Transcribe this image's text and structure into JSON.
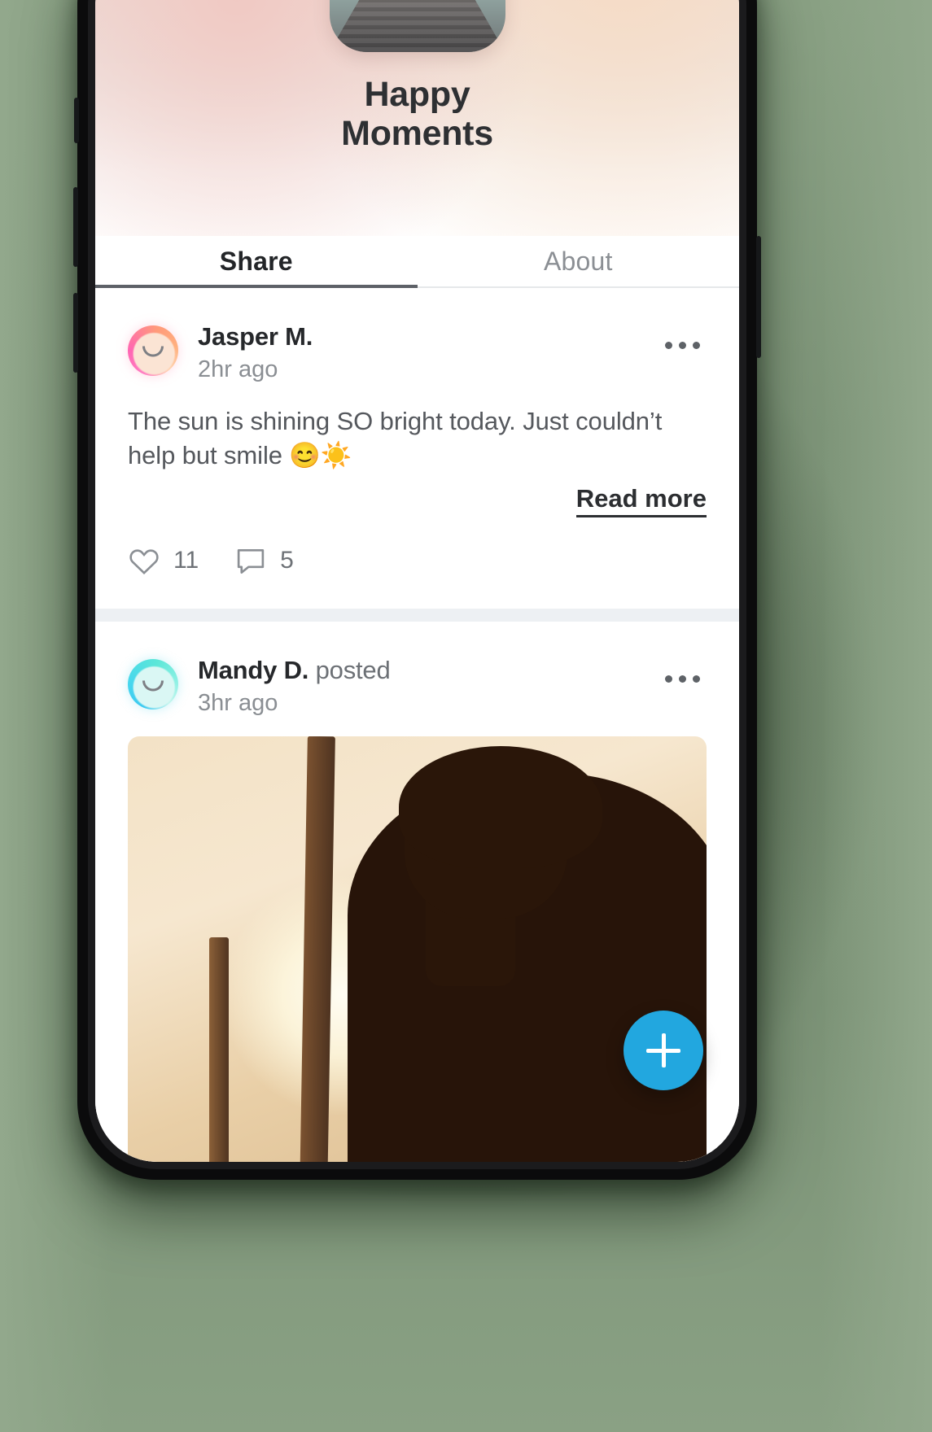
{
  "app": {
    "title_line1": "Happy",
    "title_line2": "Moments",
    "icon_name": "happy-moments-app-icon",
    "accent_color": "#22a7df",
    "tab_indicator_color": "#5d6167"
  },
  "tabs": [
    {
      "label": "Share",
      "active": true
    },
    {
      "label": "About",
      "active": false
    }
  ],
  "feed": {
    "posts": [
      {
        "author": "Jasper M.",
        "verb": "",
        "time": "2hr ago",
        "avatar": "smiley-avatar-pink",
        "text": "The sun is shining SO bright today. Just couldn’t help but smile 😊☀️",
        "read_more_label": "Read more",
        "likes": "11",
        "comments": "5",
        "more_menu": "post-options"
      },
      {
        "author": "Mandy D.",
        "verb": "posted",
        "time": "3hr ago",
        "avatar": "smiley-avatar-cyan",
        "image_alt": "woman-silhouette-at-sunset",
        "more_menu": "post-options"
      }
    ]
  },
  "fab": {
    "label": "+",
    "name": "create-post-button"
  }
}
